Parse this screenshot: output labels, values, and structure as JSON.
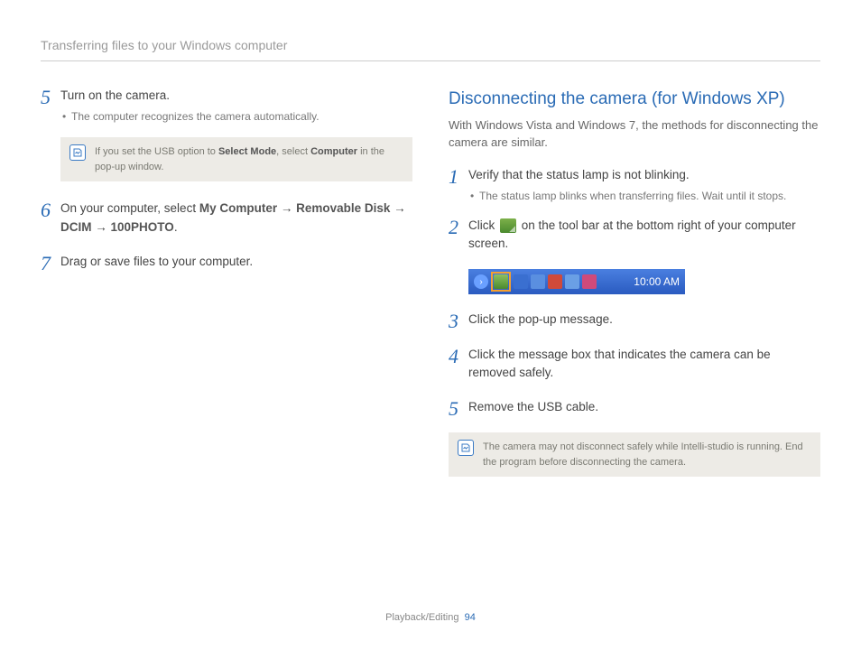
{
  "header": {
    "title": "Transferring files to your Windows computer"
  },
  "left": {
    "step5": {
      "num": "5",
      "main": "Turn on the camera.",
      "sub": "The computer recognizes the camera automatically."
    },
    "note1": {
      "pre": "If you set the USB option to ",
      "b1": "Select Mode",
      "mid": ", select ",
      "b2": "Computer",
      "post": " in the pop-up window."
    },
    "step6": {
      "num": "6",
      "pre": "On your computer, select ",
      "b1": "My Computer",
      "arr": " → ",
      "b2": "Removable Disk",
      "b3": "DCIM",
      "b4": "100PHOTO",
      "dot": "."
    },
    "step7": {
      "num": "7",
      "main": "Drag or save files to your computer."
    }
  },
  "right": {
    "heading": "Disconnecting the camera (for Windows XP)",
    "sub": "With Windows Vista and Windows 7, the methods for disconnecting the camera are similar.",
    "step1": {
      "num": "1",
      "main": "Verify that the status lamp is not blinking.",
      "sub": "The status lamp blinks when transferring files. Wait until it stops."
    },
    "step2": {
      "num": "2",
      "pre": "Click ",
      "post": " on the tool bar at the bottom right of your computer screen."
    },
    "taskbar": {
      "time": "10:00 AM"
    },
    "step3": {
      "num": "3",
      "main": "Click the pop-up message."
    },
    "step4": {
      "num": "4",
      "main": "Click the message box that indicates the camera can be removed safely."
    },
    "step5": {
      "num": "5",
      "main": "Remove the USB cable."
    },
    "note2": "The camera may not disconnect safely while Intelli-studio is running. End the program before disconnecting the camera."
  },
  "footer": {
    "section": "Playback/Editing",
    "page": "94"
  }
}
